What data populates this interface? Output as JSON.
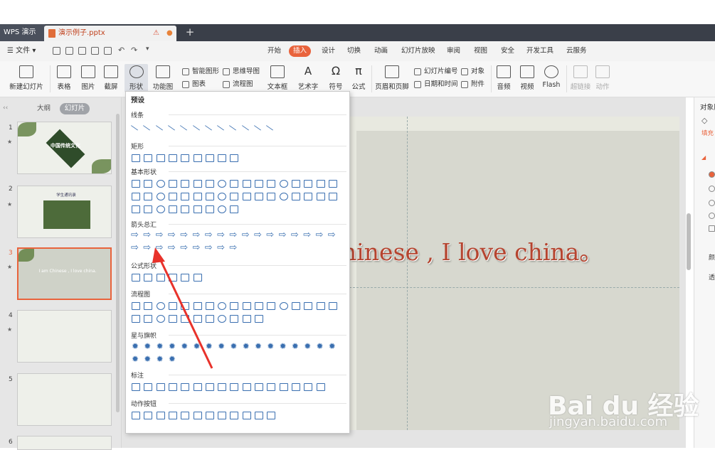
{
  "tabbar": {
    "app_tab": "WPS 演示",
    "doc_tab": "演示例子.pptx",
    "new_tab": "+"
  },
  "menubar": {
    "file": "文件",
    "tabs": [
      "开始",
      "插入",
      "设计",
      "切换",
      "动画",
      "幻灯片放映",
      "审阅",
      "视图",
      "安全",
      "开发工具",
      "云服务"
    ],
    "active_tab": "插入"
  },
  "ribbon": {
    "new_slide": "新建幻灯片",
    "table": "表格",
    "image": "图片",
    "screenshot": "截屏",
    "shapes": "形状",
    "function_chart": "功能图",
    "smart_art": "智能图形",
    "mind_map": "思维导图",
    "chart": "图表",
    "flowchart": "流程图",
    "textbox": "文本框",
    "wordart": "艺术字",
    "symbol": "符号",
    "formula": "公式",
    "header_footer": "页眉和页脚",
    "slide_number": "幻灯片编号",
    "object": "对象",
    "date_time": "日期和时间",
    "attachment": "附件",
    "audio": "音频",
    "video": "视频",
    "flash": "Flash",
    "hyperlink": "超链接",
    "action": "动作"
  },
  "left_panel": {
    "outline_tab": "大纲",
    "slides_tab": "幻灯片",
    "slides": [
      {
        "number": "1",
        "title": "中国传统文化"
      },
      {
        "number": "2",
        "title": "学生通讯录"
      },
      {
        "number": "3",
        "title": "I am Chinese , I love china."
      },
      {
        "number": "4",
        "title": ""
      },
      {
        "number": "5",
        "title": ""
      },
      {
        "number": "6",
        "title": ""
      }
    ],
    "active_slide": "3"
  },
  "slide": {
    "text": "hinese , I love china。"
  },
  "right_panel": {
    "title": "对象属性",
    "fill_tab": "填充",
    "labels": [
      "颜",
      "透"
    ]
  },
  "shape_menu": {
    "header": "预设",
    "sections": [
      "线条",
      "矩形",
      "基本形状",
      "箭头总汇",
      "公式形状",
      "流程图",
      "星与旗帜",
      "标注",
      "动作按钮"
    ]
  },
  "watermark": {
    "brand": "Bai du 经验",
    "url": "jingyan.baidu.com"
  },
  "colors": {
    "accent": "#e9633c",
    "tabbar": "#3a3f49",
    "shape_stroke": "#3a6fb0",
    "slide_text": "#b5442f",
    "arrow": "#e8322b"
  }
}
